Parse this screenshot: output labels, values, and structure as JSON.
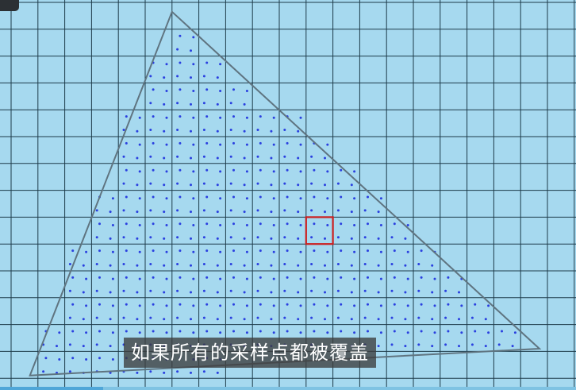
{
  "subtitle": "如果所有的采样点都被覆盖",
  "colors": {
    "background": "#a6d9ef",
    "grid_line": "#1d3b4a",
    "sample_dot": "#2a3fe0",
    "triangle_edge": "#5f7480",
    "highlight_pixel": "#cc1f1f"
  },
  "diagram": {
    "grid": {
      "columns": 22,
      "rows": 15
    },
    "triangle_vertices": [
      {
        "col": 6,
        "row": 0.35
      },
      {
        "col": 19.7,
        "row": 12.9
      },
      {
        "col": 0.7,
        "row": 13.9
      }
    ],
    "highlighted_pixel": {
      "col": 11,
      "row": 8
    },
    "samples_per_pixel": 4
  }
}
